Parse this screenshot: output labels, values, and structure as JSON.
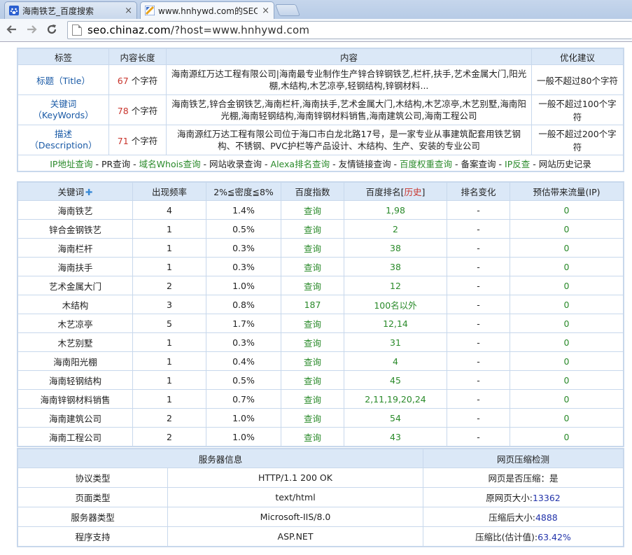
{
  "browser": {
    "tabs": [
      {
        "title": "海南铁艺_百度搜索",
        "close": "×"
      },
      {
        "title": "www.hnhywd.com的SEO",
        "close": "×"
      }
    ],
    "url_prefix": "seo.chinaz.com",
    "url_rest": "/?host=www.hnhywd.com"
  },
  "meta_table": {
    "headers": [
      "标签",
      "内容长度",
      "内容",
      "优化建议"
    ],
    "rows": [
      {
        "tag": "标题（Title）",
        "length": "67",
        "unit": "个字符",
        "content": "海南源红万达工程有限公司|海南最专业制作生产锌合锌钢铁艺,栏杆,扶手,艺术金属大门,阳光棚,木结构,木艺凉亭,轻钢结构,锌钢材料...",
        "advice": "一般不超过80个字符"
      },
      {
        "tag": "关键词\n（KeyWords）",
        "length": "78",
        "unit": "个字符",
        "content": "海南铁艺,锌合金钢铁艺,海南栏杆,海南扶手,艺术金属大门,木结构,木艺凉亭,木艺别墅,海南阳光棚,海南轻钢结构,海南锌钢材料销售,海南建筑公司,海南工程公司",
        "advice": "一般不超过100个字符"
      },
      {
        "tag": "描述\n（Description）",
        "length": "71",
        "unit": "个字符",
        "content": "海南源红万达工程有限公司位于海口市白龙北路17号，是一家专业从事建筑配套用铁艺钢构、不锈钢、PVC护栏等产品设计、木结构、生产、安装的专业公司",
        "advice": "一般不超过200个字符"
      }
    ]
  },
  "links": [
    {
      "label": "IP地址查询",
      "link": true
    },
    {
      "label": " - ",
      "link": false
    },
    {
      "label": "PR查询",
      "link": false
    },
    {
      "label": " - ",
      "link": false
    },
    {
      "label": "域名Whois查询",
      "link": true
    },
    {
      "label": " - ",
      "link": false
    },
    {
      "label": "网站收录查询",
      "link": false
    },
    {
      "label": " - ",
      "link": false
    },
    {
      "label": "Alexa排名查询",
      "link": true
    },
    {
      "label": " - ",
      "link": false
    },
    {
      "label": "友情链接查询",
      "link": false
    },
    {
      "label": " - ",
      "link": false
    },
    {
      "label": "百度权重查询",
      "link": true
    },
    {
      "label": " - ",
      "link": false
    },
    {
      "label": "备案查询",
      "link": false
    },
    {
      "label": " - ",
      "link": false
    },
    {
      "label": "IP反查",
      "link": true
    },
    {
      "label": " - ",
      "link": false
    },
    {
      "label": "网站历史记录",
      "link": false
    }
  ],
  "keyword_table": {
    "headers": {
      "keyword": "关键词",
      "plus": "✚",
      "freq": "出现频率",
      "density": "2%≦密度≦8%",
      "index": "百度指数",
      "rank_pre": "百度排名[",
      "rank_hist": "历史",
      "rank_post": "]",
      "change": "排名变化",
      "traffic": "预估带来流量(IP)"
    },
    "rows": [
      {
        "kw": "海南铁艺",
        "freq": "4",
        "density": "1.4%",
        "index": "查询",
        "rank": "1,98",
        "change": "-",
        "traffic": "0"
      },
      {
        "kw": "锌合金钢铁艺",
        "freq": "1",
        "density": "0.5%",
        "index": "查询",
        "rank": "2",
        "change": "-",
        "traffic": "0"
      },
      {
        "kw": "海南栏杆",
        "freq": "1",
        "density": "0.3%",
        "index": "查询",
        "rank": "38",
        "change": "-",
        "traffic": "0"
      },
      {
        "kw": "海南扶手",
        "freq": "1",
        "density": "0.3%",
        "index": "查询",
        "rank": "38",
        "change": "-",
        "traffic": "0"
      },
      {
        "kw": "艺术金属大门",
        "freq": "2",
        "density": "1.0%",
        "index": "查询",
        "rank": "12",
        "change": "-",
        "traffic": "0"
      },
      {
        "kw": "木结构",
        "freq": "3",
        "density": "0.8%",
        "index": "187",
        "rank": "100名以外",
        "change": "-",
        "traffic": "0"
      },
      {
        "kw": "木艺凉亭",
        "freq": "5",
        "density": "1.7%",
        "index": "查询",
        "rank": "12,14",
        "change": "-",
        "traffic": "0"
      },
      {
        "kw": "木艺别墅",
        "freq": "1",
        "density": "0.3%",
        "index": "查询",
        "rank": "31",
        "change": "-",
        "traffic": "0"
      },
      {
        "kw": "海南阳光棚",
        "freq": "1",
        "density": "0.4%",
        "index": "查询",
        "rank": "4",
        "change": "-",
        "traffic": "0"
      },
      {
        "kw": "海南轻钢结构",
        "freq": "1",
        "density": "0.5%",
        "index": "查询",
        "rank": "45",
        "change": "-",
        "traffic": "0"
      },
      {
        "kw": "海南锌钢材料销售",
        "freq": "1",
        "density": "0.7%",
        "index": "查询",
        "rank": "2,11,19,20,24",
        "change": "-",
        "traffic": "0"
      },
      {
        "kw": "海南建筑公司",
        "freq": "2",
        "density": "1.0%",
        "index": "查询",
        "rank": "54",
        "change": "-",
        "traffic": "0"
      },
      {
        "kw": "海南工程公司",
        "freq": "2",
        "density": "1.0%",
        "index": "查询",
        "rank": "43",
        "change": "-",
        "traffic": "0"
      }
    ]
  },
  "server_table": {
    "header_left": "服务器信息",
    "header_right": "网页压缩检测",
    "rows": [
      {
        "label": "协议类型",
        "value": "HTTP/1.1 200 OK",
        "right_label": "网页是否压缩：",
        "right_value": "是"
      },
      {
        "label": "页面类型",
        "value": "text/html",
        "right_label": "原网页大小:",
        "right_value": "13362"
      },
      {
        "label": "服务器类型",
        "value": "Microsoft-IIS/8.0",
        "right_label": "压缩后大小:",
        "right_value": "4888"
      },
      {
        "label": "程序支持",
        "value": "ASP.NET",
        "right_label": "压缩比(估计值):",
        "right_value": "63.42%"
      }
    ]
  }
}
